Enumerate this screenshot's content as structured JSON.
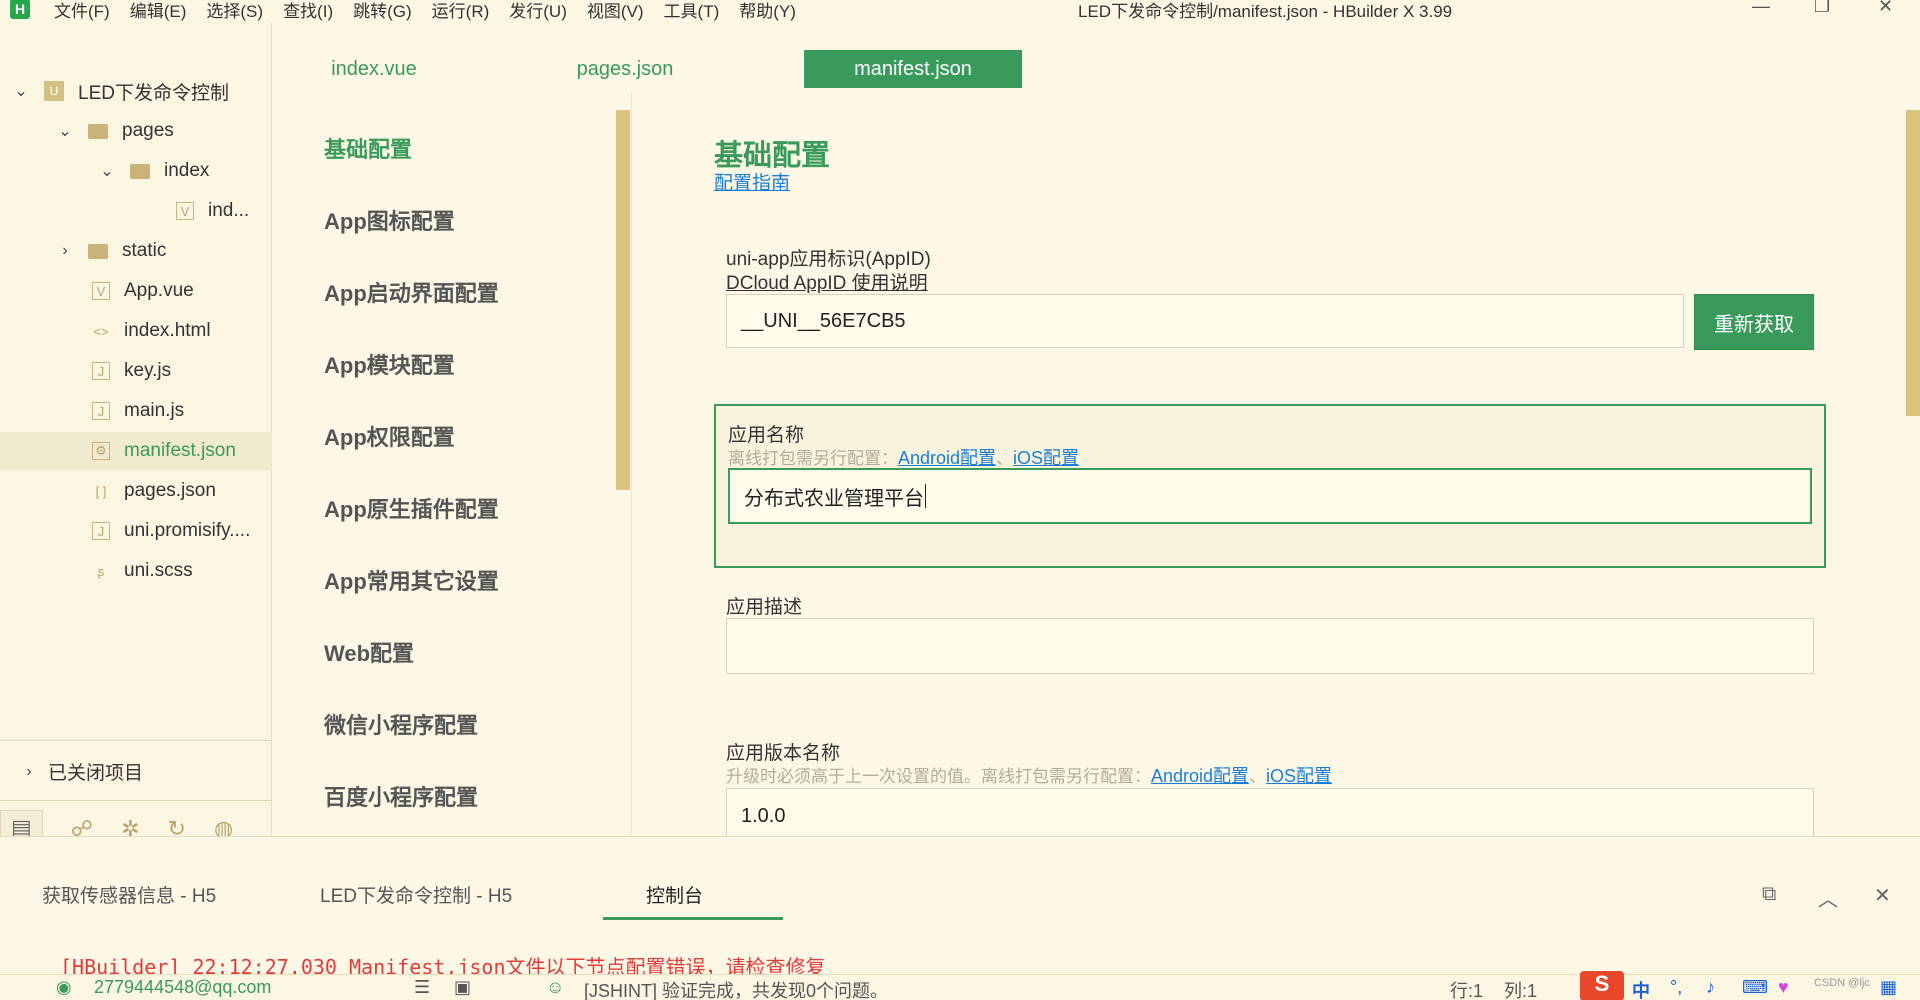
{
  "app": {
    "logo_letter": "H",
    "menu": [
      "文件(F)",
      "编辑(E)",
      "选择(S)",
      "查找(I)",
      "跳转(G)",
      "运行(R)",
      "发行(U)",
      "视图(V)",
      "工具(T)",
      "帮助(Y)"
    ],
    "window_title": "LED下发命令控制/manifest.json - HBuilder X 3.99",
    "controls": {
      "minimize": "—",
      "restore": "❐",
      "close": "✕"
    }
  },
  "project_tree": {
    "items": [
      {
        "label": "LED下发命令控制",
        "icon": "project-icon",
        "chevron": "down"
      },
      {
        "label": "pages",
        "icon": "folder-icon",
        "chevron": "down"
      },
      {
        "label": "index",
        "icon": "folder-icon",
        "chevron": "down"
      },
      {
        "label": "ind...",
        "icon": "vue-file-icon"
      },
      {
        "label": "static",
        "icon": "folder-icon",
        "chevron": "right"
      },
      {
        "label": "App.vue",
        "icon": "vue-file-icon"
      },
      {
        "label": "index.html",
        "icon": "html-file-icon"
      },
      {
        "label": "key.js",
        "icon": "js-file-icon"
      },
      {
        "label": "main.js",
        "icon": "js-file-icon"
      },
      {
        "label": "manifest.json",
        "icon": "json-settings-icon",
        "active": true
      },
      {
        "label": "pages.json",
        "icon": "json-brackets-icon"
      },
      {
        "label": "uni.promisify....",
        "icon": "js-file-icon"
      },
      {
        "label": "uni.scss",
        "icon": "scss-file-icon"
      }
    ],
    "closed_projects": "已关闭项目",
    "bottom_tools": [
      "project-explorer-icon",
      "binoculars-icon",
      "bug-icon",
      "git-icon",
      "plugin-globe-icon"
    ]
  },
  "editor_tabs": [
    {
      "label": "index.vue",
      "active": false
    },
    {
      "label": "pages.json",
      "active": false
    },
    {
      "label": "manifest.json",
      "active": true
    }
  ],
  "config_nav": [
    {
      "label": "基础配置",
      "active": true
    },
    {
      "label": "App图标配置"
    },
    {
      "label": "App启动界面配置"
    },
    {
      "label": "App模块配置"
    },
    {
      "label": "App权限配置"
    },
    {
      "label": "App原生插件配置"
    },
    {
      "label": "App常用其它设置"
    },
    {
      "label": "Web配置"
    },
    {
      "label": "微信小程序配置"
    },
    {
      "label": "百度小程序配置"
    }
  ],
  "form": {
    "title": "基础配置",
    "guide_link": "配置指南",
    "appid": {
      "label": "uni-app应用标识(AppID)",
      "link": "DCloud AppID 使用说明",
      "value": "__UNI__56E7CB5",
      "button": "重新获取"
    },
    "app_name": {
      "label": "应用名称",
      "hint": "离线打包需另行配置：",
      "link_android": "Android配置",
      "separator": "、",
      "link_ios": "iOS配置",
      "value": "分布式农业管理平台"
    },
    "app_desc": {
      "label": "应用描述",
      "value": ""
    },
    "version_name": {
      "label": "应用版本名称",
      "hint": "升级时必须高于上一次设置的值。离线打包需另行配置：",
      "link_android": "Android配置",
      "separator": "、",
      "link_ios": "iOS配置",
      "value": "1.0.0"
    }
  },
  "console": {
    "tabs": [
      {
        "label": "获取传感器信息 - H5"
      },
      {
        "label": "LED下发命令控制 - H5"
      },
      {
        "label": "控制台",
        "active": true
      }
    ],
    "line": "[HBuilder] 22:12:27.030 Manifest.json文件以下节点配置错误，请检查修复"
  },
  "status": {
    "user": "2779444548@qq.com",
    "message": "[JSHINT] 验证完成，共发现0个问题。",
    "row": "行:1",
    "col": "列:1",
    "ime": "中",
    "watermark": "CSDN @ljc"
  }
}
